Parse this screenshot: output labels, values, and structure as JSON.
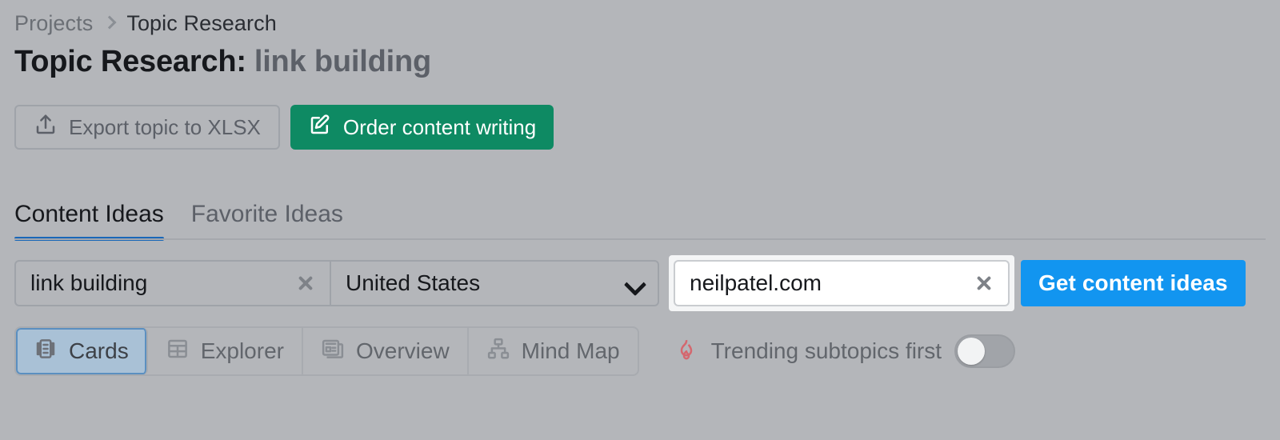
{
  "breadcrumb": {
    "root": "Projects",
    "separator_icon": "chevron-right-icon",
    "current": "Topic Research"
  },
  "header": {
    "title_prefix": "Topic Research:",
    "topic": "link building"
  },
  "actions": {
    "export": {
      "label": "Export topic to XLSX",
      "icon": "upload-icon"
    },
    "order": {
      "label": "Order content writing",
      "icon": "edit-document-icon",
      "color": "#0e8a63"
    }
  },
  "tabs": [
    {
      "label": "Content Ideas",
      "active": true
    },
    {
      "label": "Favorite Ideas",
      "active": false
    }
  ],
  "search": {
    "keyword_value": "link building",
    "keyword_clear_icon": "close-icon",
    "country_value": "United States",
    "country_caret_icon": "chevron-down-icon",
    "domain_value": "neilpatel.com",
    "domain_clear_icon": "close-icon",
    "submit_label": "Get content ideas",
    "submit_color": "#1295f0"
  },
  "views": [
    {
      "label": "Cards",
      "icon": "cards-icon",
      "active": true
    },
    {
      "label": "Explorer",
      "icon": "table-icon",
      "active": false
    },
    {
      "label": "Overview",
      "icon": "newspaper-icon",
      "active": false
    },
    {
      "label": "Mind Map",
      "icon": "hierarchy-icon",
      "active": false
    }
  ],
  "trending": {
    "icon": "flame-icon",
    "icon_color": "#d4686f",
    "label": "Trending subtopics first",
    "toggle_on": false
  },
  "theme": {
    "background": "#b4b6ba",
    "accent_blue": "#1a68b8",
    "accent_green": "#0e8a63"
  }
}
